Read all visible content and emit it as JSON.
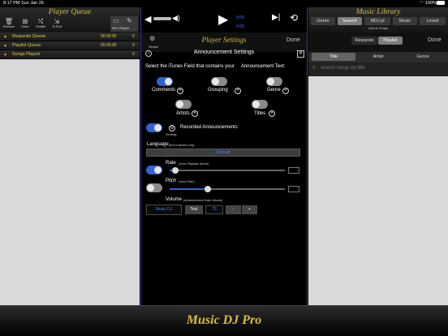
{
  "status_bar": {
    "time": "8:17 PM",
    "date": "Sun Jan 26",
    "battery": "100%"
  },
  "player_queue": {
    "title": "Player Queue",
    "tools": [
      {
        "label": "Remove",
        "icon": "trash-icon"
      },
      {
        "label": "Clear",
        "icon": "clear-icon"
      },
      {
        "label": "Shuffle",
        "icon": "shuffle-icon"
      },
      {
        "label": "To End",
        "icon": "to-end-icon"
      },
      {
        "label": "MDJ Playlist",
        "icon": "playlist-folder-icon"
      }
    ],
    "rows": [
      {
        "label": "Requests Queue",
        "time": "00:00:00",
        "count": "0"
      },
      {
        "label": "Playlist Queue",
        "time": "00:00:00",
        "count": "0"
      },
      {
        "label": "Songs Played",
        "time": "",
        "count": "0"
      }
    ]
  },
  "transport": {
    "elapsed": "0:00",
    "remaining": "0:00"
  },
  "player_settings": {
    "title": "Player Settings",
    "mode_label": "Simple",
    "done_label": "Done",
    "announcement": {
      "title": "Announcement Settings",
      "instruction": "Select the iTunes Field that contains your     Announcement Text:",
      "fields": [
        {
          "label": "Comments",
          "state": "on"
        },
        {
          "label": "Grouping",
          "state": "off"
        },
        {
          "label": "Genre",
          "state": "off"
        },
        {
          "label": "Artists",
          "state": "off"
        },
        {
          "label": "Titles",
          "state": "off"
        }
      ],
      "recorded_label": "Recorded Announcements",
      "settings_label": "Settings",
      "language_label": "Language",
      "language_note": "(text to speech only)",
      "language_value": "Default",
      "rate_label": "Rate",
      "rate_note": "(Voice Playback Speed)",
      "rate_level": 0.05,
      "pitch_label": "Pitch",
      "pitch_note": "(Voice Pitch)",
      "pitch_level": 0.33,
      "volume_label": "Volume",
      "volume_note": "(Announcement Voice Volume)",
      "volume_source": "Music DJ",
      "test_label": "Test",
      "volume_value": "75",
      "minus_label": "-",
      "plus_label": "+"
    }
  },
  "music_library": {
    "title": "Music Library",
    "tabs": [
      "Genre",
      "Search",
      "MDJ pl",
      "Music",
      "Loved"
    ],
    "selected_tab": "Search",
    "queue_songs_label": "Queue Songs",
    "source_tabs": [
      "Requests",
      "Playlist"
    ],
    "selected_source": "Playlist",
    "done_label": "Done",
    "columns": [
      "Title",
      "Artist",
      "Genre"
    ],
    "selected_column": "Title",
    "search_placeholder": "search songs by title"
  },
  "brand": "Music DJ Pro"
}
